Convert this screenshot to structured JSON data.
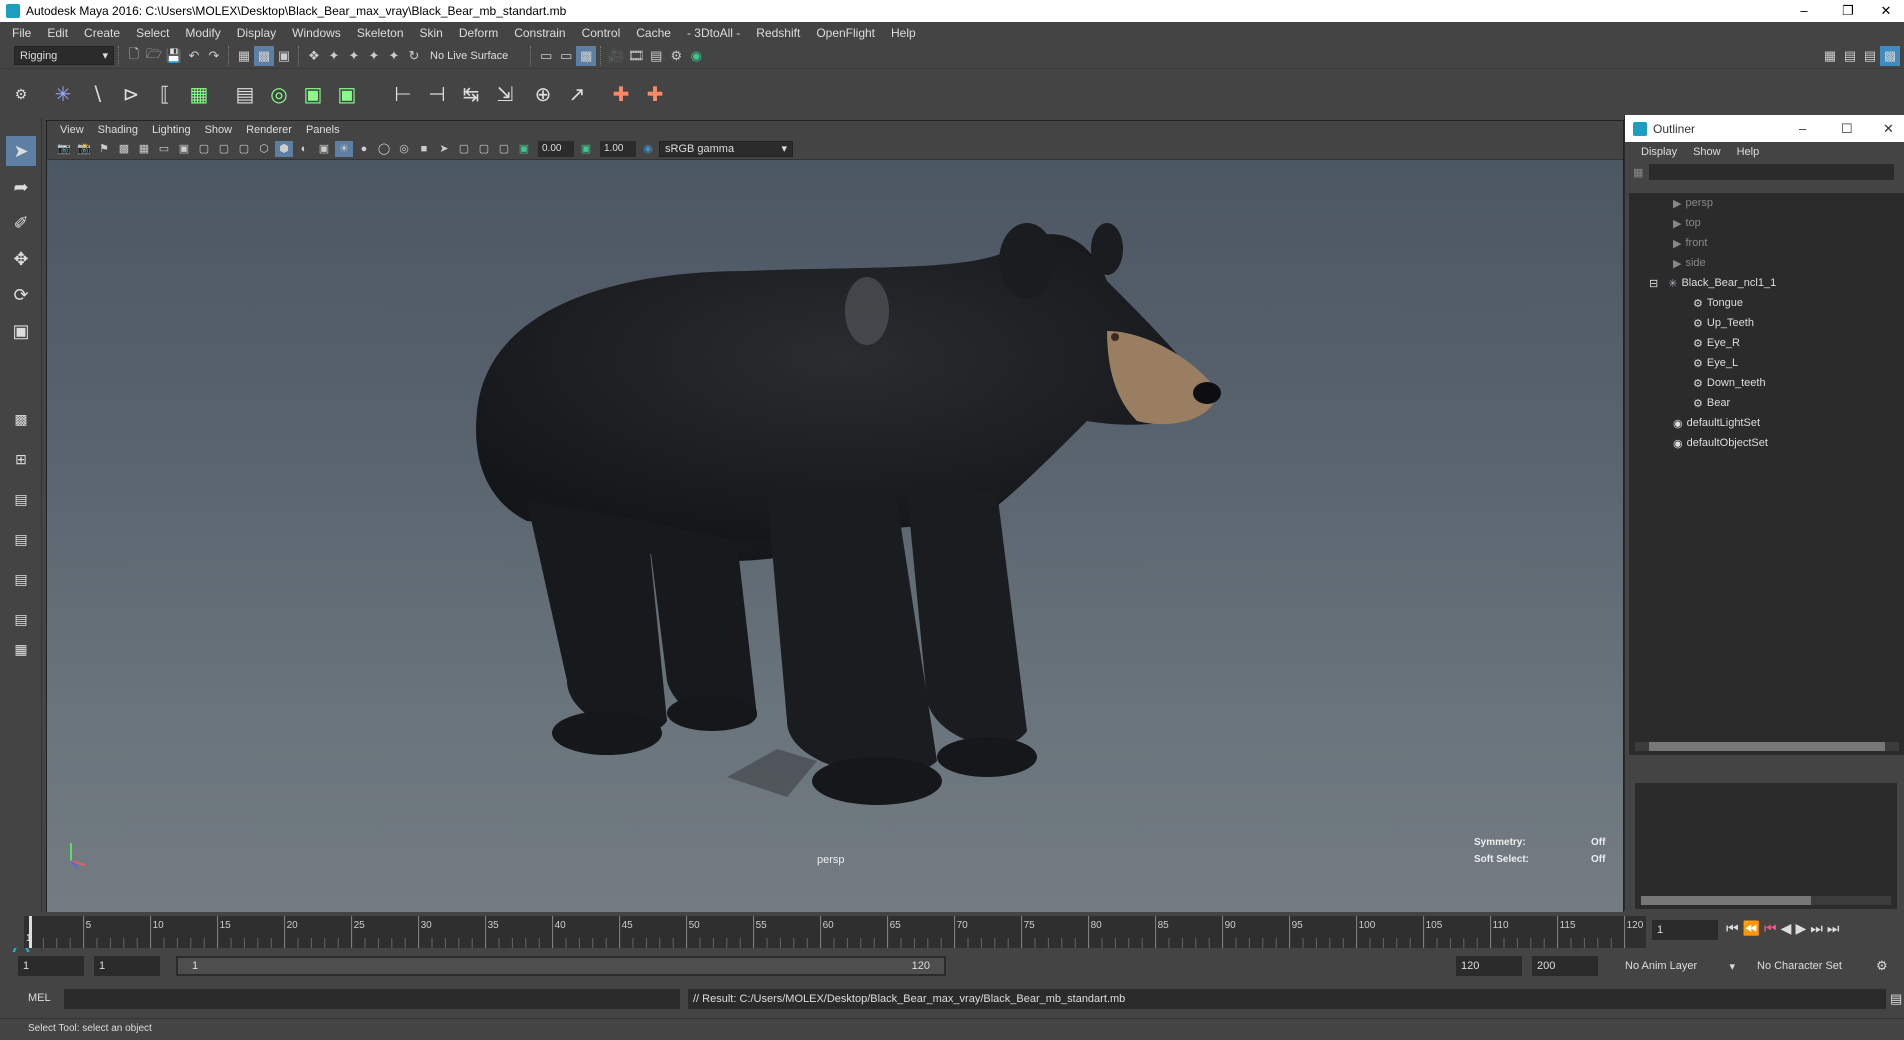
{
  "window": {
    "title": "Autodesk Maya 2016: C:\\Users\\MOLEX\\Desktop\\Black_Bear_max_vray\\Black_Bear_mb_standart.mb"
  },
  "menubar": [
    "File",
    "Edit",
    "Create",
    "Select",
    "Modify",
    "Display",
    "Windows",
    "Skeleton",
    "Skin",
    "Deform",
    "Constrain",
    "Control",
    "Cache",
    "- 3DtoAll -",
    "Redshift",
    "OpenFlight",
    "Help"
  ],
  "statusline": {
    "menuset": "Rigging",
    "live_surface": "No Live Surface"
  },
  "viewport": {
    "menu": [
      "View",
      "Shading",
      "Lighting",
      "Show",
      "Renderer",
      "Panels"
    ],
    "gamma_value": "0.00",
    "exposure_value": "1.00",
    "color_space": "sRGB gamma",
    "camera_label": "persp",
    "symmetry_label": "Symmetry:",
    "symmetry_value": "Off",
    "soft_select_label": "Soft Select:",
    "soft_select_value": "Off"
  },
  "outliner": {
    "title": "Outliner",
    "menu": [
      "Display",
      "Show",
      "Help"
    ],
    "items": [
      {
        "label": "persp",
        "icon": "camera-icon",
        "dim": true
      },
      {
        "label": "top",
        "icon": "camera-icon",
        "dim": true
      },
      {
        "label": "front",
        "icon": "camera-icon",
        "dim": true
      },
      {
        "label": "side",
        "icon": "camera-icon",
        "dim": true
      },
      {
        "label": "Black_Bear_ncl1_1",
        "icon": "joint-icon",
        "dim": false
      },
      {
        "label": "Tongue",
        "icon": "mesh-icon",
        "dim": false
      },
      {
        "label": "Up_Teeth",
        "icon": "mesh-icon",
        "dim": false
      },
      {
        "label": "Eye_R",
        "icon": "mesh-icon",
        "dim": false
      },
      {
        "label": "Eye_L",
        "icon": "mesh-icon",
        "dim": false
      },
      {
        "label": "Down_teeth",
        "icon": "mesh-icon",
        "dim": false
      },
      {
        "label": "Bear",
        "icon": "mesh-icon",
        "dim": false
      },
      {
        "label": "defaultLightSet",
        "icon": "set-icon",
        "dim": false
      },
      {
        "label": "defaultObjectSet",
        "icon": "set-icon",
        "dim": false
      }
    ]
  },
  "timeline": {
    "ticks": [
      "5",
      "10",
      "15",
      "20",
      "25",
      "30",
      "35",
      "40",
      "45",
      "50",
      "55",
      "60",
      "65",
      "70",
      "75",
      "80",
      "85",
      "90",
      "95",
      "100",
      "105",
      "110",
      "115",
      "120"
    ],
    "first_label": "1",
    "current_frame": "1"
  },
  "range": {
    "start": "1",
    "playback_start": "1",
    "slider_start": "1",
    "slider_end": "120",
    "playback_end": "120",
    "end": "200",
    "anim_layer": "No Anim Layer",
    "character_set": "No Character Set"
  },
  "cmdline": {
    "lang": "MEL",
    "result": "// Result: C:/Users/MOLEX/Desktop/Black_Bear_max_vray/Black_Bear_mb_standart.mb"
  },
  "helpline": {
    "text": "Select Tool: select an object"
  }
}
